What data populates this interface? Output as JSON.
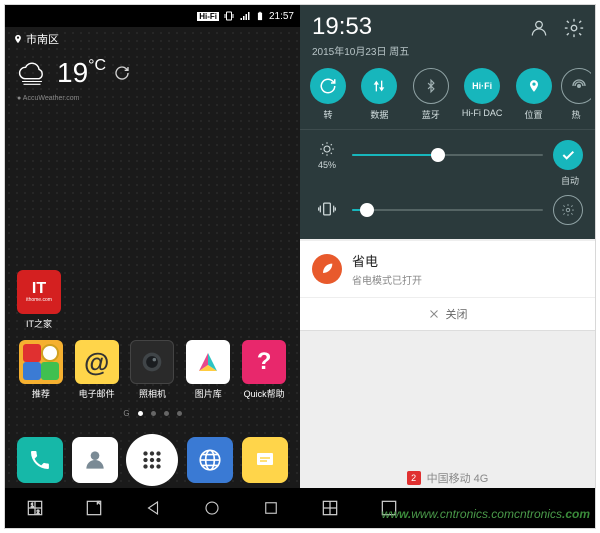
{
  "left": {
    "status": {
      "hifi": "Hi-Fi",
      "vib": "⬚",
      "signal": "📶",
      "time": "21:57"
    },
    "location": "市南区",
    "weather": {
      "temp": "19",
      "unit": "°C",
      "source": "AccuWeather.com"
    },
    "standalone": {
      "label": "IT之家"
    },
    "row1": [
      {
        "label": "推荐"
      },
      {
        "label": "电子邮件"
      },
      {
        "label": "照相机"
      },
      {
        "label": "图片库"
      },
      {
        "label": "Quick帮助"
      }
    ],
    "pager_g": "G",
    "dock": [
      {
        "name": "phone"
      },
      {
        "name": "contacts"
      },
      {
        "name": "apps"
      },
      {
        "name": "browser"
      },
      {
        "name": "messages"
      }
    ],
    "nav": [
      "dual",
      "qslide",
      "back",
      "home",
      "recent"
    ]
  },
  "right": {
    "time": "19:53",
    "date": "2015年10月23日 周五",
    "toggles": [
      {
        "label": "转",
        "on": true,
        "icon": "rotate"
      },
      {
        "label": "数据",
        "on": true,
        "icon": "data"
      },
      {
        "label": "蓝牙",
        "on": false,
        "icon": "bt"
      },
      {
        "label": "Hi-Fi DAC",
        "on": true,
        "icon": "hifi",
        "text": "Hi·Fi"
      },
      {
        "label": "位置",
        "on": true,
        "icon": "loc"
      },
      {
        "label": "热",
        "on": false,
        "icon": "hotspot"
      }
    ],
    "brightness": {
      "pct": "45%",
      "auto": "自动",
      "value": 45
    },
    "notif": {
      "title": "省电",
      "sub": "省电模式已打开",
      "close": "关闭"
    },
    "carrier": {
      "sim": "2",
      "name": "中国移动 4G"
    }
  },
  "watermark": "www.cntronics.com"
}
